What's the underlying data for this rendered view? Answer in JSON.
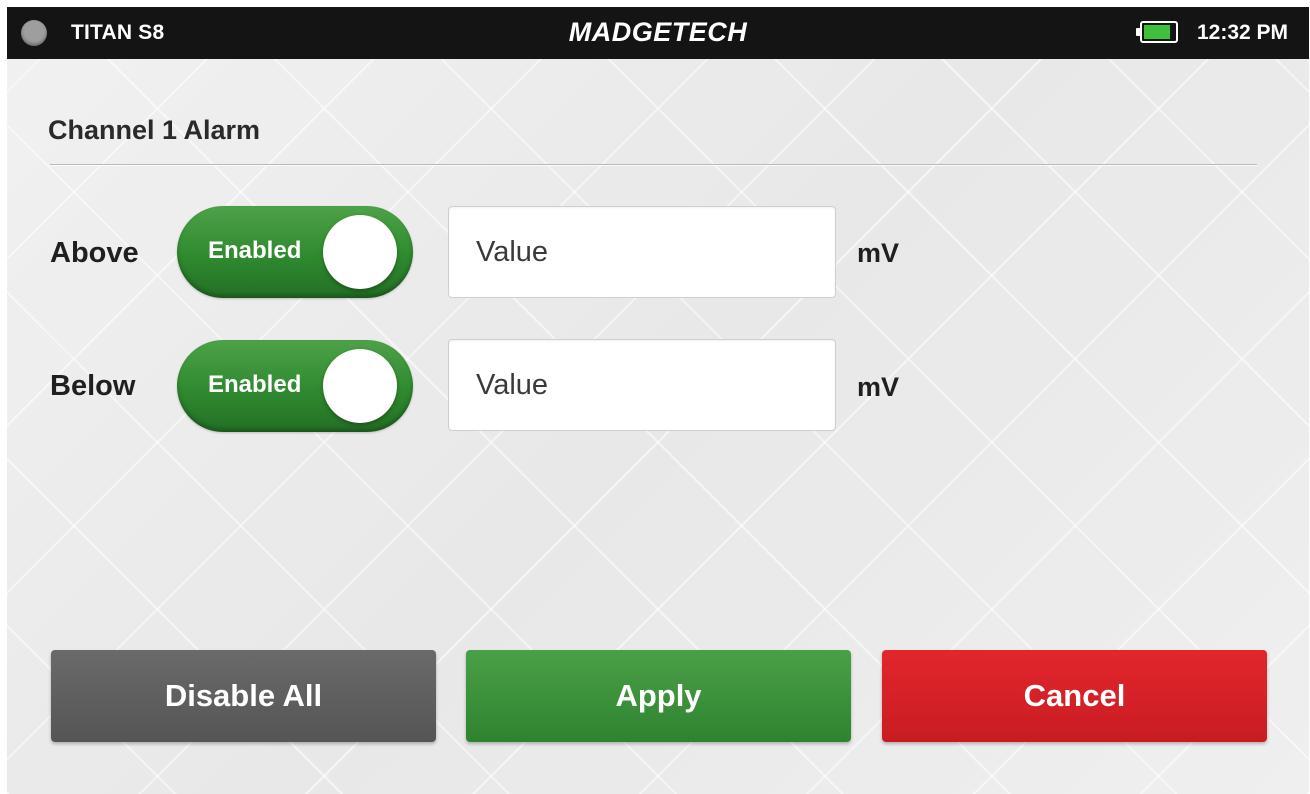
{
  "statusbar": {
    "device_name": "TITAN S8",
    "brand": "MADGETECH",
    "battery_icon": "battery-icon",
    "battery_level": 0.85,
    "battery_color": "#3fbf3a",
    "time": "12:32 PM"
  },
  "page": {
    "title": "Channel 1 Alarm"
  },
  "alarms": {
    "above": {
      "label": "Above",
      "toggle_label": "Enabled",
      "toggle_on": true,
      "value_placeholder": "Value",
      "unit": "mV"
    },
    "below": {
      "label": "Below",
      "toggle_label": "Enabled",
      "toggle_on": true,
      "value_placeholder": "Value",
      "unit": "mV"
    }
  },
  "actions": {
    "disable_all": "Disable All",
    "apply": "Apply",
    "cancel": "Cancel"
  },
  "colors": {
    "statusbar_bg": "#141414",
    "toggle_green": "#2f8a2f",
    "apply_green": "#3d9a3b",
    "cancel_red": "#d52127",
    "disable_gray": "#5f5f5f"
  }
}
